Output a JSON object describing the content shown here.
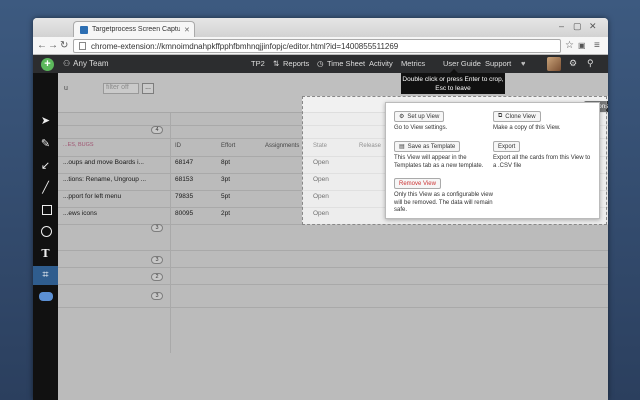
{
  "browser": {
    "tab_title": "Targetprocess Screen Captu",
    "url": "chrome-extension://kmnoimdnahpkffpphfbmhnqjjinfopjc/editor.html?id=1400855511269"
  },
  "app": {
    "team": "Any Team",
    "nav": [
      "TP2",
      "Reports",
      "Time Sheet",
      "Activity",
      "Metrics",
      "User Guide",
      "Support"
    ]
  },
  "filter": {
    "placeholder": "filter off",
    "more": "...",
    "actions_label": "Actions"
  },
  "tooltip": "Double click or press Enter to crop, Esc to leave",
  "grid": {
    "group_label": "...ES, BUGS",
    "headers": {
      "id": "ID",
      "effort": "Effort",
      "assignments": "Assignments",
      "state": "State",
      "release": "Release"
    },
    "group_count": "4",
    "rows": [
      {
        "name": "...oups and move Boards i...",
        "id": "68147",
        "effort": "8pt",
        "state": "Open"
      },
      {
        "name": "...tions: Rename, Ungroup ...",
        "id": "68153",
        "effort": "3pt",
        "state": "Open"
      },
      {
        "name": "...pport for left menu",
        "id": "79835",
        "effort": "5pt",
        "state": "Open"
      },
      {
        "name": "...ews icons",
        "id": "80095",
        "effort": "2pt",
        "state": "Open"
      }
    ],
    "other_counts": [
      "3",
      "3",
      "2",
      "3"
    ]
  },
  "popup": {
    "setup": {
      "label": "Set up View",
      "desc": "Go to View settings."
    },
    "clone": {
      "label": "Clone View",
      "desc": "Make a copy of this View."
    },
    "template": {
      "label": "Save as Template",
      "desc": "This View will appear in the Templates tab as a new template."
    },
    "export": {
      "label": "Export",
      "desc": "Export all the cards from this View to a .CSV file"
    },
    "remove": {
      "label": "Remove View",
      "desc": "Only this View as a configurable view will be removed. The data will remain safe."
    }
  },
  "colors": {
    "accent_blue": "#2f5d8e",
    "add_green": "#5cb85c",
    "remove_red": "#cc3333"
  }
}
